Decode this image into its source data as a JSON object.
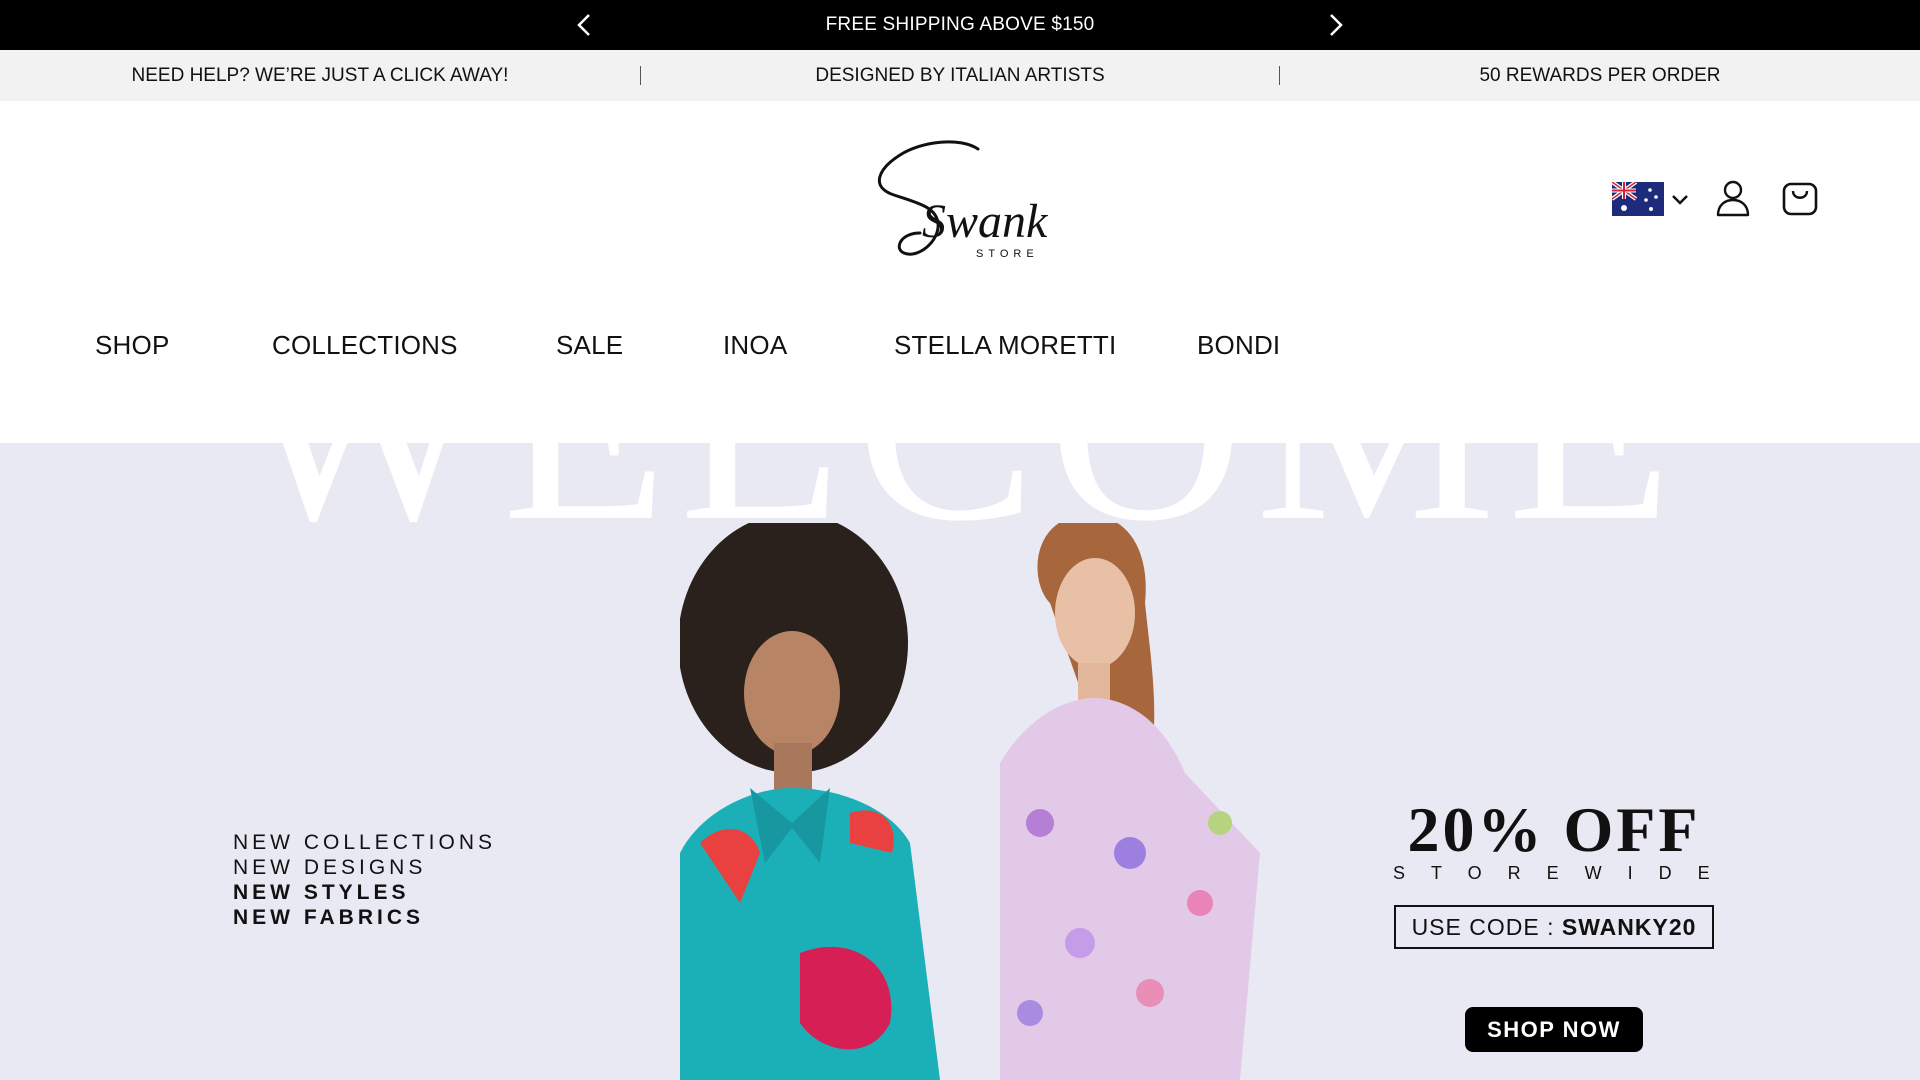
{
  "announcement": {
    "text": "FREE SHIPPING ABOVE $150",
    "prev_icon": "chevron-left-icon",
    "next_icon": "chevron-right-icon"
  },
  "info_strip": {
    "items": [
      "NEED HELP? WE’RE JUST A CLICK AWAY!",
      "DESIGNED BY ITALIAN ARTISTS",
      "50 REWARDS PER ORDER"
    ]
  },
  "header": {
    "logo": {
      "text": "Swank",
      "subtext": "STORE"
    },
    "icons": {
      "country_flag": "australia-flag-icon",
      "country_dropdown": "chevron-down-icon",
      "account": "user-icon",
      "cart": "shopping-bag-icon"
    }
  },
  "nav": {
    "items": [
      "SHOP",
      "COLLECTIONS",
      "SALE",
      "INOA",
      "STELLA MORETTI",
      "BONDI"
    ]
  },
  "hero": {
    "background_word": "WELCOME",
    "taglines": [
      "NEW COLLECTIONS",
      "NEW DESIGNS",
      "NEW STYLES",
      "NEW FABRICS"
    ],
    "offer_title": "20% OFF",
    "offer_subtitle": "STOREWIDE",
    "code_label": "USE CODE : ",
    "code_value": "SWANKY20",
    "cta": "SHOP NOW"
  },
  "colors": {
    "announcement_bg": "#000000",
    "info_bg": "#f2f2f2",
    "hero_bg": "#e9e9f3",
    "cta_bg": "#000000"
  }
}
